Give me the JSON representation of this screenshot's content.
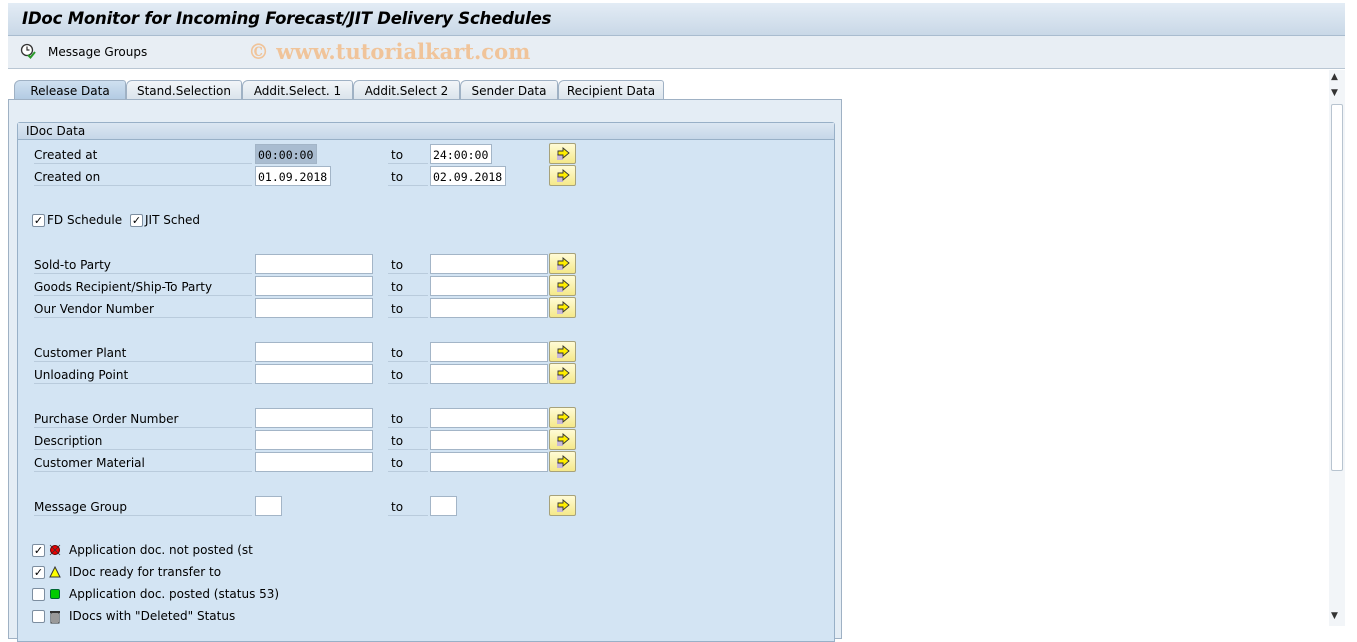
{
  "title": "IDoc Monitor for Incoming Forecast/JIT Delivery Schedules",
  "toolbar": {
    "message_groups": "Message Groups",
    "icon": "clock-check-icon"
  },
  "watermark": "© www.tutorialkart.com",
  "tabs": [
    {
      "label": "Release Data",
      "active": true
    },
    {
      "label": "Stand.Selection"
    },
    {
      "label": "Addit.Select. 1"
    },
    {
      "label": "Addit.Select 2"
    },
    {
      "label": "Sender Data"
    },
    {
      "label": "Recipient Data"
    }
  ],
  "group": {
    "title": "IDoc Data"
  },
  "to_label": "to",
  "rows": [
    {
      "label": "Created at",
      "from": "00:00:00",
      "to": "24:00:00"
    },
    {
      "label": "Created on",
      "from": "01.09.2018",
      "to": "02.09.2018"
    },
    {
      "label": "Sold-to Party",
      "from": "",
      "to": ""
    },
    {
      "label": "Goods Recipient/Ship-To Party",
      "from": "",
      "to": ""
    },
    {
      "label": "Our Vendor Number",
      "from": "",
      "to": ""
    },
    {
      "label": "Customer Plant",
      "from": "",
      "to": ""
    },
    {
      "label": "Unloading Point",
      "from": "",
      "to": ""
    },
    {
      "label": "Purchase Order Number",
      "from": "",
      "to": ""
    },
    {
      "label": "Description",
      "from": "",
      "to": ""
    },
    {
      "label": "Customer Material",
      "from": "",
      "to": ""
    },
    {
      "label": "Message Group",
      "from": "",
      "to": ""
    }
  ],
  "schedule_checks": [
    {
      "label": "FD Schedule",
      "checked": true
    },
    {
      "label": "JIT Sched",
      "checked": true
    }
  ],
  "status_checks": [
    {
      "label": "Application doc. not posted (st",
      "checked": true,
      "icon": "red-status-icon"
    },
    {
      "label": "IDoc ready for transfer to",
      "checked": true,
      "icon": "yellow-warning-icon"
    },
    {
      "label": "Application doc. posted (status 53)",
      "checked": false,
      "icon": "green-status-icon"
    },
    {
      "label": "IDocs with \"Deleted\" Status",
      "checked": false,
      "icon": "trash-icon"
    }
  ]
}
